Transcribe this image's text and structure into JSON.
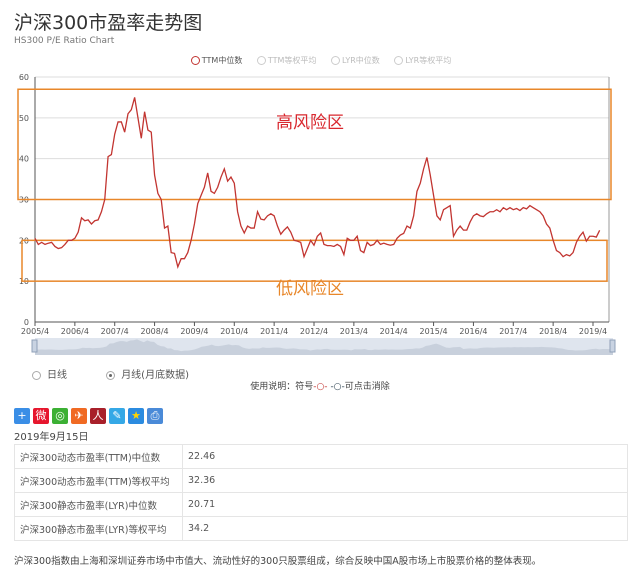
{
  "header": {
    "title": "沪深300市盈率走势图",
    "subtitle": "HS300 P/E Ratio Chart"
  },
  "legend": [
    {
      "label": "TTM中位数",
      "active": true
    },
    {
      "label": "TTM等权平均",
      "active": false
    },
    {
      "label": "LYR中位数",
      "active": false
    },
    {
      "label": "LYR等权平均",
      "active": false
    }
  ],
  "colors": {
    "line": "#c23531",
    "band": "#e8872a",
    "high_text": "#d9272e",
    "low_text": "#e8872a"
  },
  "chart_data": {
    "type": "line",
    "title": "沪深300市盈率走势图",
    "series": [
      {
        "name": "TTM中位数",
        "start": "2005/4",
        "frequency": "monthly",
        "values": [
          20.5,
          19,
          19.5,
          19,
          19.3,
          19.5,
          18.5,
          18,
          18.2,
          19,
          20,
          20,
          20.5,
          22,
          25.5,
          24.8,
          25,
          24,
          24.8,
          25,
          27,
          30,
          40.5,
          41,
          46,
          49,
          49,
          46.5,
          51,
          52,
          55,
          50,
          45,
          51.5,
          47,
          46.5,
          36,
          31.5,
          30,
          23,
          23.5,
          17,
          16.8,
          13.5,
          15.5,
          15.5,
          17,
          20,
          24,
          29,
          31,
          33,
          36.5,
          32,
          31.5,
          33,
          35.5,
          37.5,
          34.5,
          35.5,
          34,
          27,
          23.5,
          21.8,
          23.5,
          23,
          23,
          27,
          25.2,
          25,
          26,
          26.5,
          26,
          23.5,
          21.5,
          22.5,
          23.3,
          22,
          20,
          19.8,
          19.5,
          16,
          18,
          20,
          18.8,
          21,
          21.8,
          19,
          18.7,
          18.7,
          18.5,
          19,
          18.5,
          16.5,
          20.5,
          20,
          20,
          21,
          17.5,
          17,
          19.5,
          18.7,
          19,
          20,
          19,
          19.3,
          19,
          18.8,
          19,
          20.5,
          21.3,
          21.7,
          23.5,
          23,
          26,
          32,
          34,
          37.5,
          40.3,
          36,
          31,
          26,
          25,
          27.5,
          28,
          28.5,
          21,
          22.5,
          23.5,
          22.5,
          22.5,
          24.5,
          26,
          26.5,
          26,
          25.8,
          26.5,
          27,
          27,
          27.5,
          27,
          28,
          27.5,
          28,
          27.5,
          27.8,
          27.3,
          28,
          27.7,
          28.5,
          28,
          27.5,
          27,
          26,
          24,
          23,
          20,
          17.5,
          17,
          16,
          16.5,
          16.2,
          17,
          19.5,
          21,
          22,
          19.8,
          21,
          21,
          20.8,
          22.46
        ]
      }
    ],
    "x_ticks": [
      "2005/4",
      "2006/4",
      "2007/4",
      "2008/4",
      "2009/4",
      "2010/4",
      "2011/4",
      "2012/4",
      "2013/4",
      "2014/4",
      "2015/4",
      "2016/4",
      "2017/4",
      "2018/4",
      "2019/4"
    ],
    "y_ticks": [
      0,
      10,
      20,
      30,
      40,
      50,
      60
    ],
    "ylim": [
      0,
      60
    ],
    "grid": true,
    "zones": [
      {
        "label": "高风险区",
        "from": 30,
        "to": 57
      },
      {
        "label": "低风险区",
        "from": 10,
        "to": 20
      }
    ]
  },
  "view": {
    "options": [
      {
        "label": "日线",
        "selected": false
      },
      {
        "label": "月线(月底数据)",
        "selected": true
      }
    ],
    "note_prefix": "使用说明：符号",
    "note_suffix": "可点击消除"
  },
  "share_icons": [
    "plus-icon",
    "weibo-icon",
    "wechat-icon",
    "tqq-icon",
    "renren-icon",
    "pencil-icon",
    "star-icon",
    "print-icon"
  ],
  "date": "2019年9月15日",
  "table": [
    {
      "label": "沪深300动态市盈率(TTM)中位数",
      "value": "22.46"
    },
    {
      "label": "沪深300动态市盈率(TTM)等权平均",
      "value": "32.36"
    },
    {
      "label": "沪深300静态市盈率(LYR)中位数",
      "value": "20.71"
    },
    {
      "label": "沪深300静态市盈率(LYR)等权平均",
      "value": "34.2"
    }
  ],
  "description": "沪深300指数由上海和深圳证券市场中市值大、流动性好的300只股票组成，综合反映中国A股市场上市股票价格的整体表现。"
}
